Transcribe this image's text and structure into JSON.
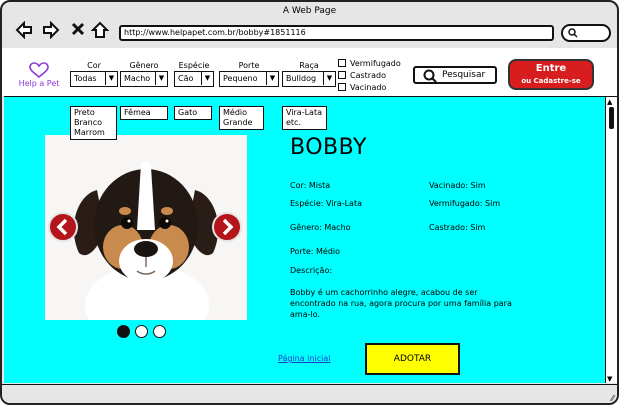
{
  "window": {
    "title": "A Web Page"
  },
  "browser": {
    "url": "http://www.helpapet.com.br/bobby#1851116"
  },
  "logo": {
    "text": "Help a Pet"
  },
  "filters": {
    "cor": {
      "label": "Cor",
      "selected": "Todas",
      "options": [
        "Preto",
        "Branco",
        "Marrom"
      ]
    },
    "genero": {
      "label": "Gênero",
      "selected": "Macho",
      "options": [
        "Fêmea"
      ]
    },
    "especie": {
      "label": "Espécie",
      "selected": "Cão",
      "options": [
        "Gato"
      ]
    },
    "porte": {
      "label": "Porte",
      "selected": "Pequeno",
      "options": [
        "Médio",
        "Grande"
      ]
    },
    "raca": {
      "label": "Raça",
      "selected": "Bulldog",
      "options": [
        "Vira-Lata",
        "etc."
      ]
    }
  },
  "checkboxes": [
    {
      "label": "Vermifugado",
      "checked": false
    },
    {
      "label": "Castrado",
      "checked": false
    },
    {
      "label": "Vacinado",
      "checked": false
    }
  ],
  "search_button": {
    "label": "Pesquisar"
  },
  "cta": {
    "line1": "Entre",
    "line2": "ou Cadastre-se"
  },
  "pet": {
    "name": "BOBBY",
    "cor": "Cor: Mista",
    "especie": "Espécie: Vira-Lata",
    "genero": "Gênero: Macho",
    "porte": "Porte: Médio",
    "vacinado": "Vacinado: Sim",
    "vermifugado": "Vermifugado: Sim",
    "castrado": "Castrado: Sim",
    "descricao_label": "Descrição:",
    "descricao": "Bobby é um cachorrinho alegre, acabou de ser encontrado na rua, agora procura por uma família para ama-lo."
  },
  "carousel": {
    "slides": 3,
    "active_index": 0
  },
  "links": {
    "home": "Página inicial"
  },
  "actions": {
    "adopt": "ADOTAR"
  },
  "colors": {
    "content_bg": "#00ffff",
    "cta_bg": "#d71d1d",
    "adopt_bg": "#ffff00",
    "logo": "#8d3ad8",
    "carousel_arrow": "#b3151b"
  }
}
